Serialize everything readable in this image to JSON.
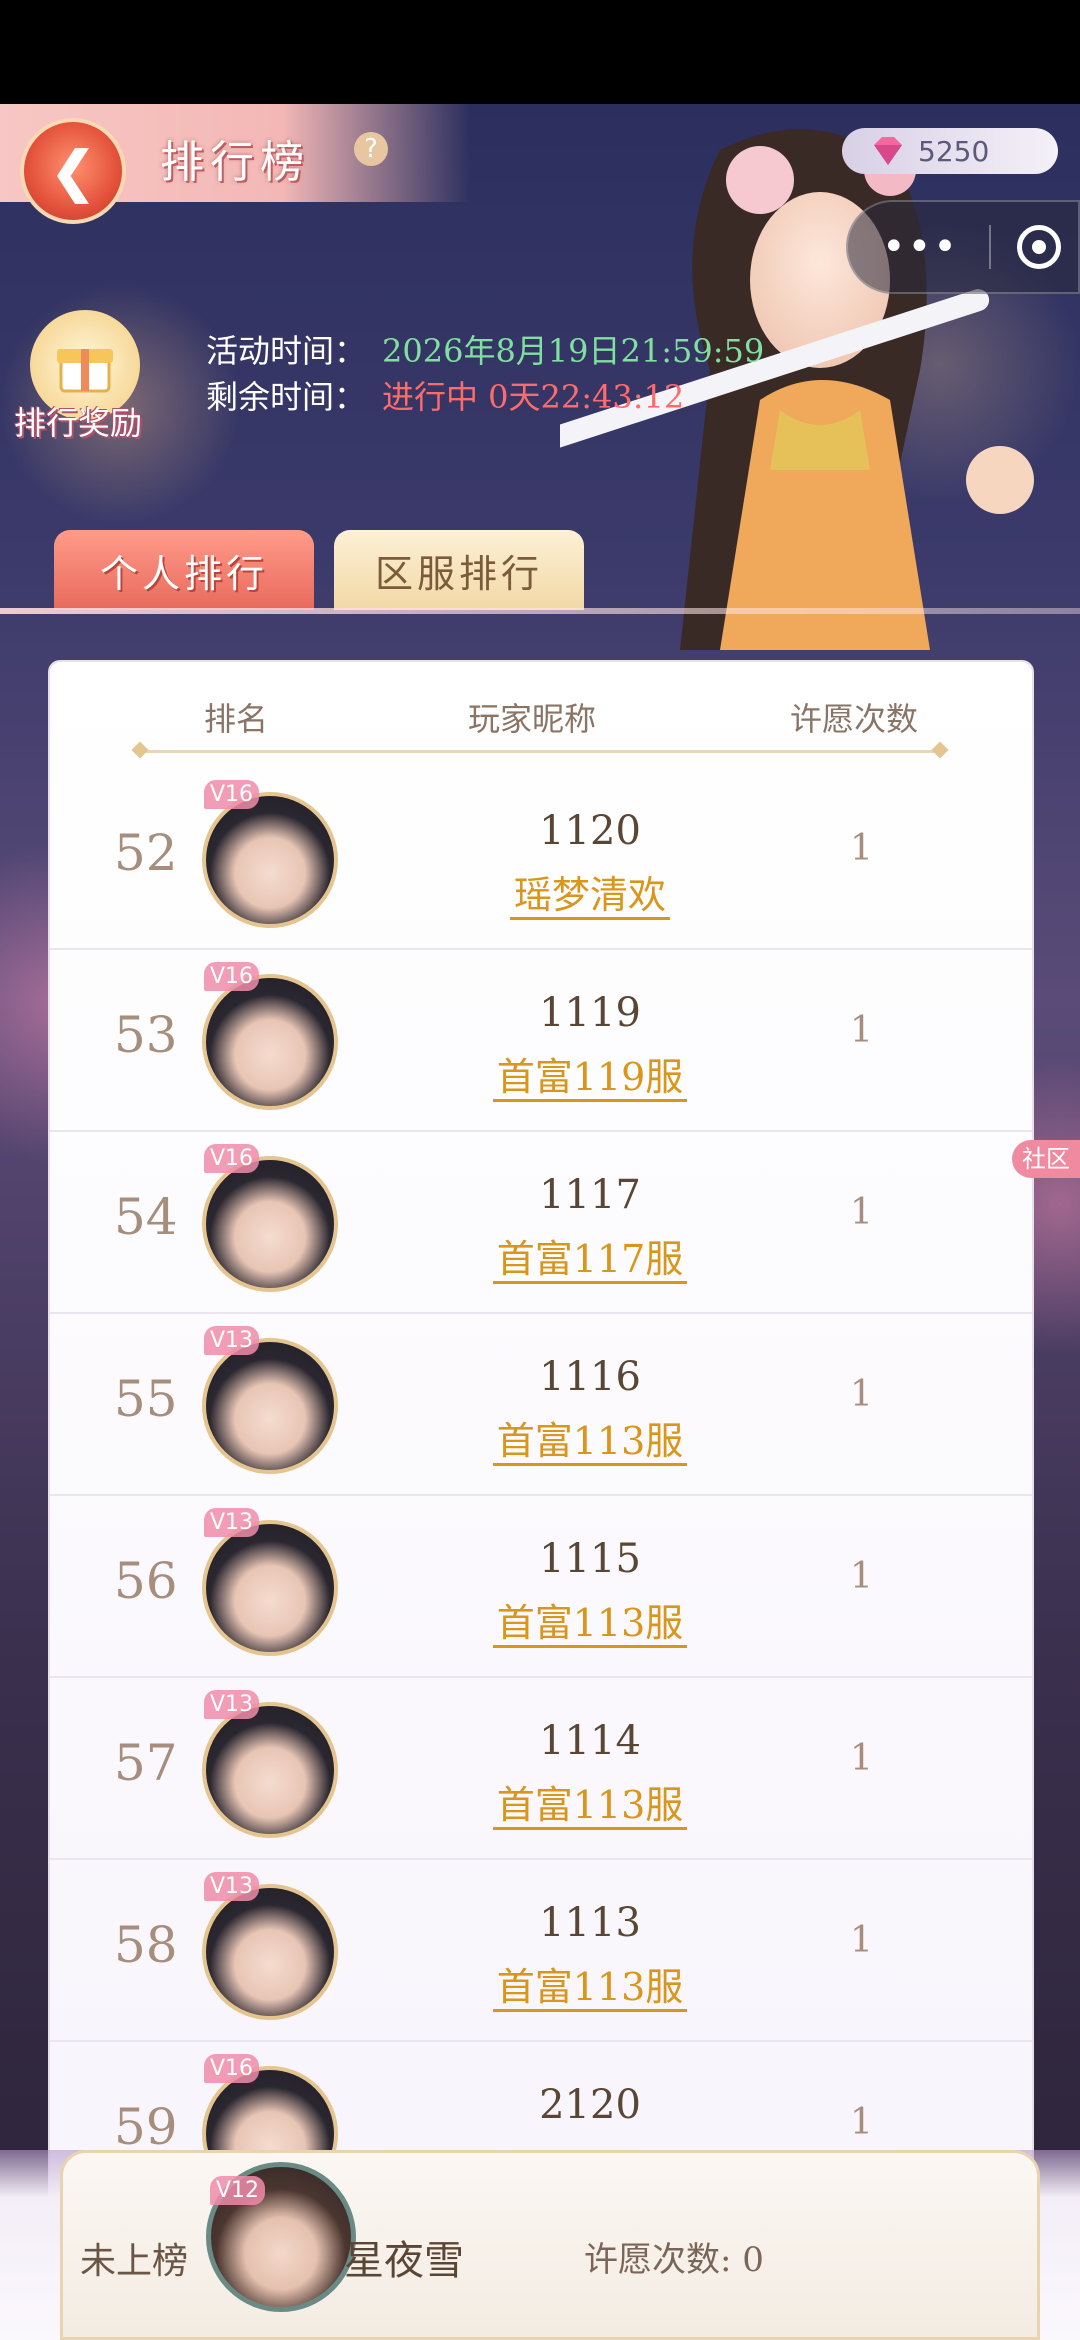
{
  "header": {
    "title": "排行榜",
    "back_icon": "back-arrow-icon",
    "help_icon": "question-icon",
    "gems": "5250",
    "capsule_more": "•••"
  },
  "event": {
    "reward_label": "排行奖励",
    "activity_label": "活动时间：",
    "activity_value": "2026年8月19日21:59:59",
    "remaining_label": "剩余时间：",
    "remaining_value": "进行中 0天22:43:12"
  },
  "tabs": [
    {
      "label": "个人排行",
      "active": true
    },
    {
      "label": "区服排行",
      "active": false
    }
  ],
  "table": {
    "headers": [
      "排名",
      "玩家昵称",
      "许愿次数"
    ],
    "rows": [
      {
        "rank": "52",
        "vip": "V16",
        "id": "1120",
        "name": "瑶梦清欢",
        "wishes": "1"
      },
      {
        "rank": "53",
        "vip": "V16",
        "id": "1119",
        "name": "首富119服",
        "wishes": "1"
      },
      {
        "rank": "54",
        "vip": "V16",
        "id": "1117",
        "name": "首富117服",
        "wishes": "1"
      },
      {
        "rank": "55",
        "vip": "V13",
        "id": "1116",
        "name": "首富113服",
        "wishes": "1"
      },
      {
        "rank": "56",
        "vip": "V13",
        "id": "1115",
        "name": "首富113服",
        "wishes": "1"
      },
      {
        "rank": "57",
        "vip": "V13",
        "id": "1114",
        "name": "首富113服",
        "wishes": "1"
      },
      {
        "rank": "58",
        "vip": "V13",
        "id": "1113",
        "name": "首富113服",
        "wishes": "1"
      },
      {
        "rank": "59",
        "vip": "V16",
        "id": "2120",
        "name": "",
        "wishes": "1"
      }
    ]
  },
  "self": {
    "status": "未上榜",
    "vip": "V12",
    "name": "星夜雪",
    "wishes": "许愿次数: 0"
  },
  "side": {
    "tag": "社区"
  },
  "colors": {
    "accent_gold": "#d9961b",
    "time_green": "#7fe0a0",
    "time_red": "#ff6b6b",
    "tab_active": "#e86a5c"
  }
}
